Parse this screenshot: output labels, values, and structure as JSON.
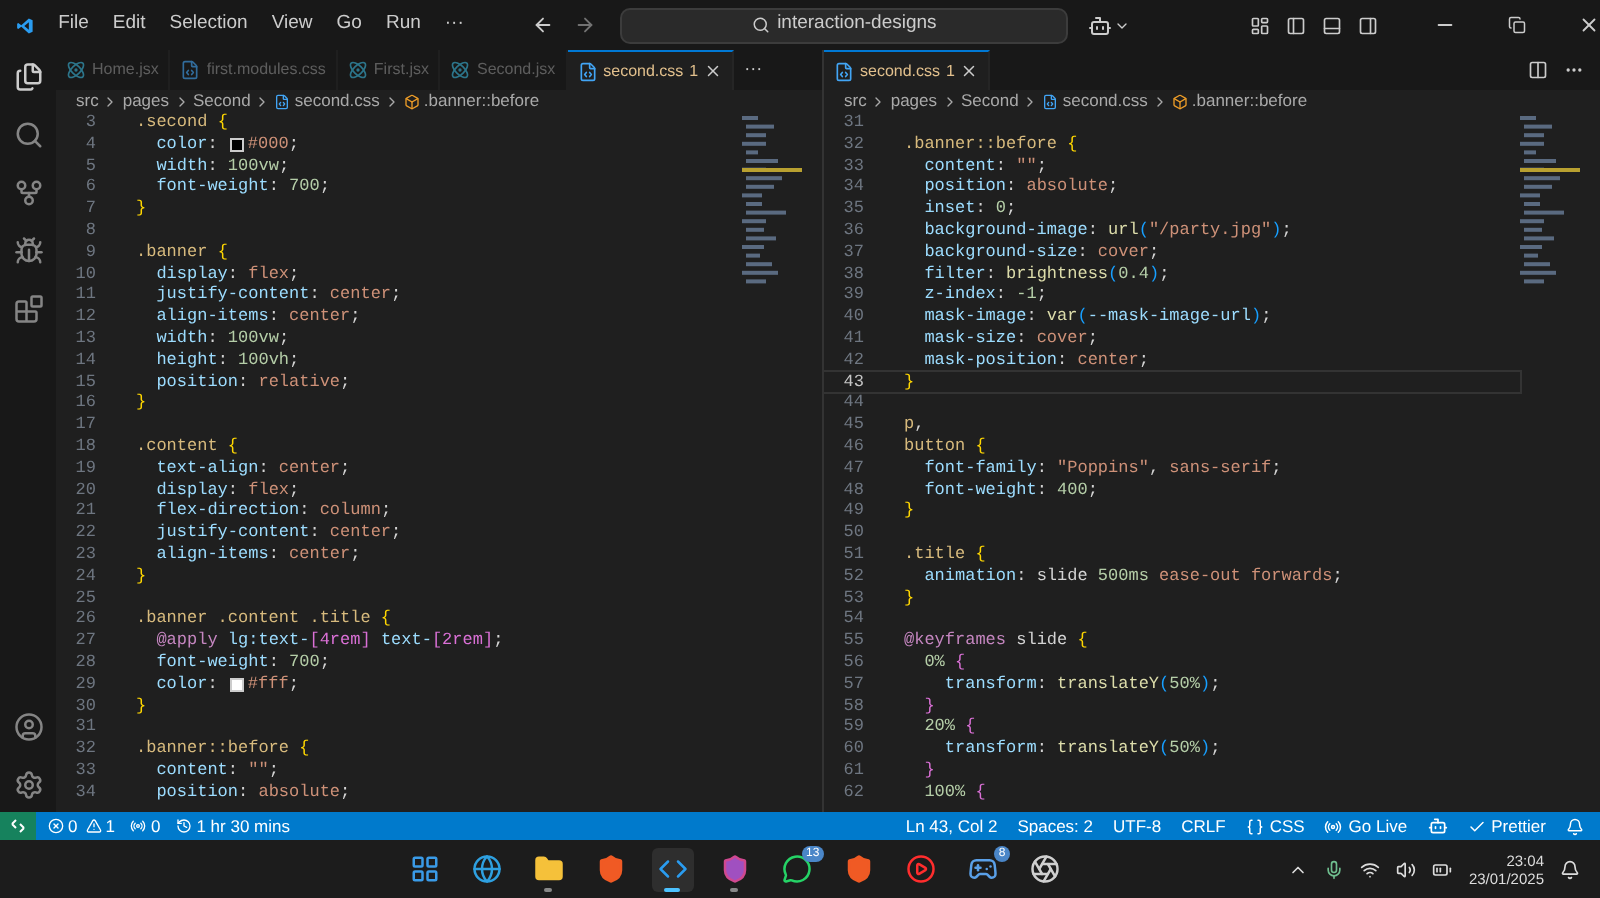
{
  "menu": [
    "File",
    "Edit",
    "Selection",
    "View",
    "Go",
    "Run",
    "···"
  ],
  "search": {
    "value": "interaction-designs"
  },
  "panes": [
    {
      "tabs": [
        {
          "label": "Home.jsx",
          "kind": "react",
          "selected": false
        },
        {
          "label": "first.modules.css",
          "kind": "css",
          "selected": false
        },
        {
          "label": "First.jsx",
          "kind": "react",
          "selected": false
        },
        {
          "label": "Second.jsx",
          "kind": "react",
          "selected": false
        },
        {
          "label": "second.css",
          "badge": "1",
          "kind": "css",
          "selected": true
        }
      ],
      "more": "···",
      "breadcrumbs": [
        "src",
        "pages",
        "Second",
        "second.css",
        ".banner::before"
      ],
      "lines": [
        {
          "n": "3",
          "current": false,
          "tokens": [
            {
              "t": ".second ",
              "kind": "s"
            },
            {
              "t": "{",
              "kind": "b"
            }
          ]
        },
        {
          "n": "4",
          "current": false,
          "tokens": [
            {
              "t": "  color",
              "kind": "p"
            },
            {
              "t": ": ",
              "kind": "x"
            },
            {
              "kind": "swatch",
              "color": "#000000"
            },
            {
              "t": "#000",
              "kind": "v"
            },
            {
              "t": ";",
              "kind": "x"
            }
          ]
        },
        {
          "n": "5",
          "current": false,
          "tokens": [
            {
              "t": "  width",
              "kind": "p"
            },
            {
              "t": ": ",
              "kind": "x"
            },
            {
              "t": "100vw",
              "kind": "n"
            },
            {
              "t": ";",
              "kind": "x"
            }
          ]
        },
        {
          "n": "6",
          "current": false,
          "tokens": [
            {
              "t": "  font-weight",
              "kind": "p"
            },
            {
              "t": ": ",
              "kind": "x"
            },
            {
              "t": "700",
              "kind": "n"
            },
            {
              "t": ";",
              "kind": "x"
            }
          ]
        },
        {
          "n": "7",
          "current": false,
          "tokens": [
            {
              "t": "}",
              "kind": "b"
            }
          ]
        },
        {
          "n": "8",
          "current": false
        },
        {
          "n": "9",
          "current": false,
          "tokens": [
            {
              "t": ".banner ",
              "kind": "s"
            },
            {
              "t": "{",
              "kind": "b"
            }
          ]
        },
        {
          "n": "10",
          "current": false,
          "tokens": [
            {
              "t": "  display",
              "kind": "p"
            },
            {
              "t": ": ",
              "kind": "x"
            },
            {
              "t": "flex",
              "kind": "v"
            },
            {
              "t": ";",
              "kind": "x"
            }
          ]
        },
        {
          "n": "11",
          "current": false,
          "tokens": [
            {
              "t": "  justify-content",
              "kind": "p"
            },
            {
              "t": ": ",
              "kind": "x"
            },
            {
              "t": "center",
              "kind": "v"
            },
            {
              "t": ";",
              "kind": "x"
            }
          ]
        },
        {
          "n": "12",
          "current": false,
          "tokens": [
            {
              "t": "  align-items",
              "kind": "p"
            },
            {
              "t": ": ",
              "kind": "x"
            },
            {
              "t": "center",
              "kind": "v"
            },
            {
              "t": ";",
              "kind": "x"
            }
          ]
        },
        {
          "n": "13",
          "current": false,
          "tokens": [
            {
              "t": "  width",
              "kind": "p"
            },
            {
              "t": ": ",
              "kind": "x"
            },
            {
              "t": "100vw",
              "kind": "n"
            },
            {
              "t": ";",
              "kind": "x"
            }
          ]
        },
        {
          "n": "14",
          "current": false,
          "tokens": [
            {
              "t": "  height",
              "kind": "p"
            },
            {
              "t": ": ",
              "kind": "x"
            },
            {
              "t": "100vh",
              "kind": "n"
            },
            {
              "t": ";",
              "kind": "x"
            }
          ]
        },
        {
          "n": "15",
          "current": false,
          "tokens": [
            {
              "t": "  position",
              "kind": "p"
            },
            {
              "t": ": ",
              "kind": "x"
            },
            {
              "t": "relative",
              "kind": "v"
            },
            {
              "t": ";",
              "kind": "x"
            }
          ]
        },
        {
          "n": "16",
          "current": false,
          "tokens": [
            {
              "t": "}",
              "kind": "b"
            }
          ]
        },
        {
          "n": "17",
          "current": false
        },
        {
          "n": "18",
          "current": false,
          "tokens": [
            {
              "t": ".content ",
              "kind": "s"
            },
            {
              "t": "{",
              "kind": "b"
            }
          ]
        },
        {
          "n": "19",
          "current": false,
          "tokens": [
            {
              "t": "  text-align",
              "kind": "p"
            },
            {
              "t": ": ",
              "kind": "x"
            },
            {
              "t": "center",
              "kind": "v"
            },
            {
              "t": ";",
              "kind": "x"
            }
          ]
        },
        {
          "n": "20",
          "current": false,
          "tokens": [
            {
              "t": "  display",
              "kind": "p"
            },
            {
              "t": ": ",
              "kind": "x"
            },
            {
              "t": "flex",
              "kind": "v"
            },
            {
              "t": ";",
              "kind": "x"
            }
          ]
        },
        {
          "n": "21",
          "current": false,
          "tokens": [
            {
              "t": "  flex-direction",
              "kind": "p"
            },
            {
              "t": ": ",
              "kind": "x"
            },
            {
              "t": "column",
              "kind": "v"
            },
            {
              "t": ";",
              "kind": "x"
            }
          ]
        },
        {
          "n": "22",
          "current": false,
          "tokens": [
            {
              "t": "  justify-content",
              "kind": "p"
            },
            {
              "t": ": ",
              "kind": "x"
            },
            {
              "t": "center",
              "kind": "v"
            },
            {
              "t": ";",
              "kind": "x"
            }
          ]
        },
        {
          "n": "23",
          "current": false,
          "tokens": [
            {
              "t": "  align-items",
              "kind": "p"
            },
            {
              "t": ": ",
              "kind": "x"
            },
            {
              "t": "center",
              "kind": "v"
            },
            {
              "t": ";",
              "kind": "x"
            }
          ]
        },
        {
          "n": "24",
          "current": false,
          "tokens": [
            {
              "t": "}",
              "kind": "b"
            }
          ]
        },
        {
          "n": "25",
          "current": false
        },
        {
          "n": "26",
          "current": false,
          "tokens": [
            {
              "t": ".banner .content .title ",
              "kind": "s"
            },
            {
              "t": "{",
              "kind": "b"
            }
          ]
        },
        {
          "n": "27",
          "current": false,
          "tokens": [
            {
              "t": "  @apply",
              "kind": "a"
            },
            {
              "t": " lg:text-",
              "kind": "p"
            },
            {
              "t": "[4rem]",
              "kind": "b2"
            },
            {
              "t": " text-",
              "kind": "p"
            },
            {
              "t": "[2rem]",
              "kind": "b2"
            },
            {
              "t": ";",
              "kind": "x"
            }
          ]
        },
        {
          "n": "28",
          "current": false,
          "tokens": [
            {
              "t": "  font-weight",
              "kind": "p"
            },
            {
              "t": ": ",
              "kind": "x"
            },
            {
              "t": "700",
              "kind": "n"
            },
            {
              "t": ";",
              "kind": "x"
            }
          ]
        },
        {
          "n": "29",
          "current": false,
          "tokens": [
            {
              "t": "  color",
              "kind": "p"
            },
            {
              "t": ": ",
              "kind": "x"
            },
            {
              "kind": "swatch",
              "color": "#ffffff"
            },
            {
              "t": "#fff",
              "kind": "v"
            },
            {
              "t": ";",
              "kind": "x"
            }
          ]
        },
        {
          "n": "30",
          "current": false,
          "tokens": [
            {
              "t": "}",
              "kind": "b"
            }
          ]
        },
        {
          "n": "31",
          "current": false
        },
        {
          "n": "32",
          "current": false,
          "tokens": [
            {
              "t": ".banner::before ",
              "kind": "s"
            },
            {
              "t": "{",
              "kind": "b"
            }
          ]
        },
        {
          "n": "33",
          "current": false,
          "tokens": [
            {
              "t": "  content",
              "kind": "p"
            },
            {
              "t": ": ",
              "kind": "x"
            },
            {
              "t": "\"\"",
              "kind": "q"
            },
            {
              "t": ";",
              "kind": "x"
            }
          ]
        },
        {
          "n": "34",
          "current": false,
          "tokens": [
            {
              "t": "  position",
              "kind": "p"
            },
            {
              "t": ": ",
              "kind": "x"
            },
            {
              "t": "absolute",
              "kind": "v"
            },
            {
              "t": ";",
              "kind": "x"
            }
          ]
        }
      ]
    },
    {
      "tabs": [
        {
          "label": "second.css",
          "badge": "1",
          "kind": "css",
          "selected": true
        }
      ],
      "breadcrumbs": [
        "src",
        "pages",
        "Second",
        "second.css",
        ".banner::before"
      ],
      "lines": [
        {
          "n": "31",
          "current": false
        },
        {
          "n": "32",
          "current": false,
          "tokens": [
            {
              "t": ".banner::before ",
              "kind": "s"
            },
            {
              "t": "{",
              "kind": "b"
            }
          ]
        },
        {
          "n": "33",
          "current": false,
          "tokens": [
            {
              "t": "  content",
              "kind": "p"
            },
            {
              "t": ": ",
              "kind": "x"
            },
            {
              "t": "\"\"",
              "kind": "q"
            },
            {
              "t": ";",
              "kind": "x"
            }
          ]
        },
        {
          "n": "34",
          "current": false,
          "tokens": [
            {
              "t": "  position",
              "kind": "p"
            },
            {
              "t": ": ",
              "kind": "x"
            },
            {
              "t": "absolute",
              "kind": "v"
            },
            {
              "t": ";",
              "kind": "x"
            }
          ]
        },
        {
          "n": "35",
          "current": false,
          "tokens": [
            {
              "t": "  inset",
              "kind": "p"
            },
            {
              "t": ": ",
              "kind": "x"
            },
            {
              "t": "0",
              "kind": "n"
            },
            {
              "t": ";",
              "kind": "x"
            }
          ]
        },
        {
          "n": "36",
          "current": false,
          "tokens": [
            {
              "t": "  background-image",
              "kind": "p"
            },
            {
              "t": ": ",
              "kind": "x"
            },
            {
              "t": "url",
              "kind": "f"
            },
            {
              "t": "(",
              "kind": "b3"
            },
            {
              "t": "\"/party.jpg\"",
              "kind": "q"
            },
            {
              "t": ")",
              "kind": "b3"
            },
            {
              "t": ";",
              "kind": "x"
            }
          ]
        },
        {
          "n": "37",
          "current": false,
          "tokens": [
            {
              "t": "  background-size",
              "kind": "p"
            },
            {
              "t": ": ",
              "kind": "x"
            },
            {
              "t": "cover",
              "kind": "v"
            },
            {
              "t": ";",
              "kind": "x"
            }
          ]
        },
        {
          "n": "38",
          "current": false,
          "tokens": [
            {
              "t": "  filter",
              "kind": "p"
            },
            {
              "t": ": ",
              "kind": "x"
            },
            {
              "t": "brightness",
              "kind": "f"
            },
            {
              "t": "(",
              "kind": "b3"
            },
            {
              "t": "0.4",
              "kind": "n"
            },
            {
              "t": ")",
              "kind": "b3"
            },
            {
              "t": ";",
              "kind": "x"
            }
          ]
        },
        {
          "n": "39",
          "current": false,
          "tokens": [
            {
              "t": "  z-index",
              "kind": "p"
            },
            {
              "t": ": ",
              "kind": "x"
            },
            {
              "t": "-1",
              "kind": "n"
            },
            {
              "t": ";",
              "kind": "x"
            }
          ]
        },
        {
          "n": "40",
          "current": false,
          "tokens": [
            {
              "t": "  mask-image",
              "kind": "p"
            },
            {
              "t": ": ",
              "kind": "x"
            },
            {
              "t": "var",
              "kind": "f"
            },
            {
              "t": "(",
              "kind": "b3"
            },
            {
              "t": "--mask-image-url",
              "kind": "p"
            },
            {
              "t": ")",
              "kind": "b3"
            },
            {
              "t": ";",
              "kind": "x"
            }
          ]
        },
        {
          "n": "41",
          "current": false,
          "tokens": [
            {
              "t": "  mask-size",
              "kind": "p"
            },
            {
              "t": ": ",
              "kind": "x"
            },
            {
              "t": "cover",
              "kind": "v"
            },
            {
              "t": ";",
              "kind": "x"
            }
          ]
        },
        {
          "n": "42",
          "current": false,
          "tokens": [
            {
              "t": "  mask-position",
              "kind": "p"
            },
            {
              "t": ": ",
              "kind": "x"
            },
            {
              "t": "center",
              "kind": "v"
            },
            {
              "t": ";",
              "kind": "x"
            }
          ]
        },
        {
          "n": "43",
          "current": true,
          "tokens": [
            {
              "t": "}",
              "kind": "b"
            }
          ]
        },
        {
          "n": "44",
          "current": false
        },
        {
          "n": "45",
          "current": false,
          "tokens": [
            {
              "t": "p",
              "kind": "s"
            },
            {
              "t": ",",
              "kind": "x"
            }
          ]
        },
        {
          "n": "46",
          "current": false,
          "tokens": [
            {
              "t": "button ",
              "kind": "s"
            },
            {
              "t": "{",
              "kind": "b"
            }
          ]
        },
        {
          "n": "47",
          "current": false,
          "tokens": [
            {
              "t": "  font-family",
              "kind": "p"
            },
            {
              "t": ": ",
              "kind": "x"
            },
            {
              "t": "\"Poppins\"",
              "kind": "q"
            },
            {
              "t": ", ",
              "kind": "x"
            },
            {
              "t": "sans-serif",
              "kind": "v"
            },
            {
              "t": ";",
              "kind": "x"
            }
          ]
        },
        {
          "n": "48",
          "current": false,
          "tokens": [
            {
              "t": "  font-weight",
              "kind": "p"
            },
            {
              "t": ": ",
              "kind": "x"
            },
            {
              "t": "400",
              "kind": "n"
            },
            {
              "t": ";",
              "kind": "x"
            }
          ]
        },
        {
          "n": "49",
          "current": false,
          "tokens": [
            {
              "t": "}",
              "kind": "b"
            }
          ]
        },
        {
          "n": "50",
          "current": false
        },
        {
          "n": "51",
          "current": false,
          "tokens": [
            {
              "t": ".title ",
              "kind": "s"
            },
            {
              "t": "{",
              "kind": "b"
            }
          ]
        },
        {
          "n": "52",
          "current": false,
          "tokens": [
            {
              "t": "  animation",
              "kind": "p"
            },
            {
              "t": ": ",
              "kind": "x"
            },
            {
              "t": "slide ",
              "kind": "x"
            },
            {
              "t": "500ms",
              "kind": "n"
            },
            {
              "t": " ease-out forwards",
              "kind": "v"
            },
            {
              "t": ";",
              "kind": "x"
            }
          ]
        },
        {
          "n": "53",
          "current": false,
          "tokens": [
            {
              "t": "}",
              "kind": "b"
            }
          ]
        },
        {
          "n": "54",
          "current": false
        },
        {
          "n": "55",
          "current": false,
          "tokens": [
            {
              "t": "@keyframes",
              "kind": "a"
            },
            {
              "t": " slide ",
              "kind": "x"
            },
            {
              "t": "{",
              "kind": "b"
            }
          ]
        },
        {
          "n": "56",
          "current": false,
          "tokens": [
            {
              "t": "  0% ",
              "kind": "n"
            },
            {
              "t": "{",
              "kind": "b2"
            }
          ]
        },
        {
          "n": "57",
          "current": false,
          "tokens": [
            {
              "t": "    transform",
              "kind": "p"
            },
            {
              "t": ": ",
              "kind": "x"
            },
            {
              "t": "translateY",
              "kind": "f"
            },
            {
              "t": "(",
              "kind": "b3"
            },
            {
              "t": "50%",
              "kind": "n"
            },
            {
              "t": ")",
              "kind": "b3"
            },
            {
              "t": ";",
              "kind": "x"
            }
          ]
        },
        {
          "n": "58",
          "current": false,
          "tokens": [
            {
              "t": "  }",
              "kind": "b2"
            }
          ]
        },
        {
          "n": "59",
          "current": false,
          "tokens": [
            {
              "t": "  20% ",
              "kind": "n"
            },
            {
              "t": "{",
              "kind": "b2"
            }
          ]
        },
        {
          "n": "60",
          "current": false,
          "tokens": [
            {
              "t": "    transform",
              "kind": "p"
            },
            {
              "t": ": ",
              "kind": "x"
            },
            {
              "t": "translateY",
              "kind": "f"
            },
            {
              "t": "(",
              "kind": "b3"
            },
            {
              "t": "50%",
              "kind": "n"
            },
            {
              "t": ")",
              "kind": "b3"
            },
            {
              "t": ";",
              "kind": "x"
            }
          ]
        },
        {
          "n": "61",
          "current": false,
          "tokens": [
            {
              "t": "  }",
              "kind": "b2"
            }
          ]
        },
        {
          "n": "62",
          "current": false,
          "tokens": [
            {
              "t": "  100% ",
              "kind": "n"
            },
            {
              "t": "{",
              "kind": "b2"
            }
          ]
        }
      ]
    }
  ],
  "status_bar": {
    "errors": "0",
    "warnings": "1",
    "ports": "0",
    "timer": "1 hr 30 mins",
    "right": [
      {
        "kind": "text",
        "label": "Ln 43, Col 2"
      },
      {
        "kind": "text",
        "label": "Spaces: 2"
      },
      {
        "kind": "text",
        "label": "UTF-8"
      },
      {
        "kind": "text",
        "label": "CRLF"
      },
      {
        "kind": "language",
        "label": "CSS"
      },
      {
        "kind": "live",
        "label": "Go Live"
      },
      {
        "kind": "copilot"
      },
      {
        "kind": "prettier",
        "label": "Prettier"
      },
      {
        "kind": "bell"
      }
    ]
  },
  "taskbar": {
    "apps": [
      {
        "kind": "start",
        "running": false,
        "focused": false
      },
      {
        "kind": "edge",
        "running": false,
        "focused": false
      },
      {
        "kind": "folder",
        "running": true,
        "focused": false
      },
      {
        "kind": "brave",
        "running": false,
        "focused": false
      },
      {
        "kind": "vscode",
        "running": true,
        "focused": true
      },
      {
        "kind": "brave-nightly",
        "running": true,
        "focused": false
      },
      {
        "kind": "whatsapp",
        "badge": "13",
        "running": false,
        "focused": false
      },
      {
        "kind": "brave",
        "running": false,
        "focused": false
      },
      {
        "kind": "youtube",
        "running": false,
        "focused": false
      },
      {
        "kind": "steam",
        "badge": "8",
        "running": false,
        "focused": false
      },
      {
        "kind": "obs",
        "running": false,
        "focused": false
      }
    ],
    "time": "23:04",
    "date": "23/01/2025"
  }
}
